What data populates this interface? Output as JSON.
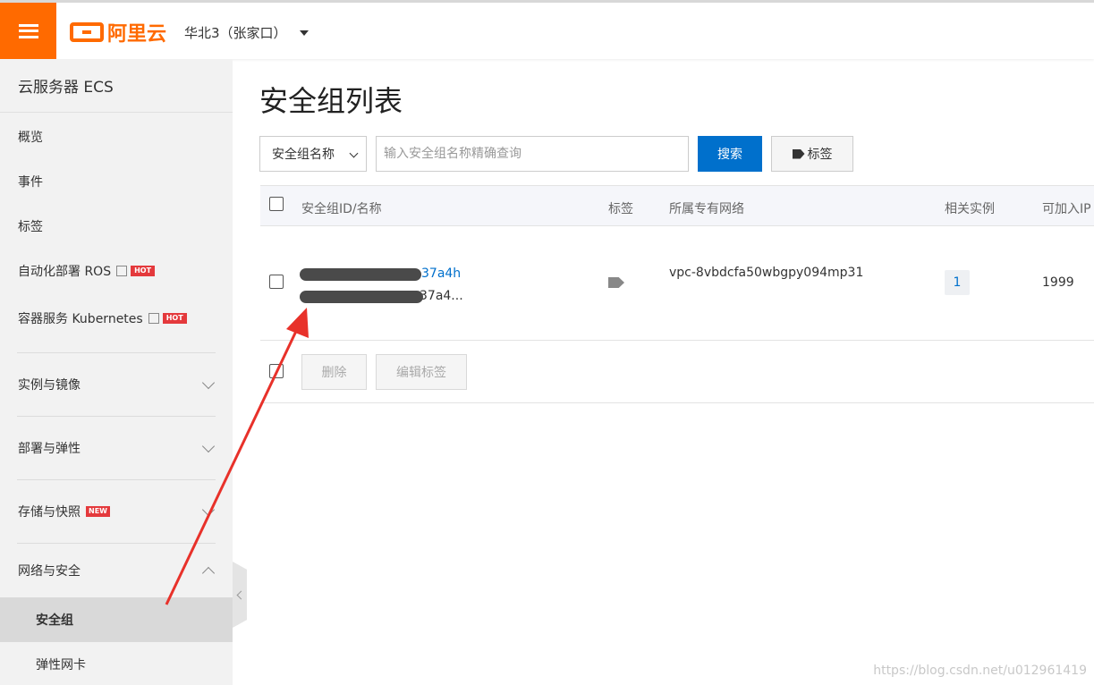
{
  "header": {
    "menu_icon": "hamburger-icon",
    "logo_text": "阿里云",
    "region": "华北3（张家口）",
    "brand_color": "#ff6a00"
  },
  "sidebar": {
    "title": "云服务器 ECS",
    "items": [
      {
        "label": "概览"
      },
      {
        "label": "事件"
      },
      {
        "label": "标签"
      },
      {
        "label": "自动化部署 ROS",
        "badge": "HOT"
      },
      {
        "label": "容器服务 Kubernetes",
        "badge": "HOT"
      }
    ],
    "groups": [
      {
        "label": "实例与镜像"
      },
      {
        "label": "部署与弹性"
      },
      {
        "label": "存储与快照",
        "badge": "NEW"
      },
      {
        "label": "网络与安全"
      }
    ],
    "sub_items": [
      {
        "label": "安全组"
      },
      {
        "label": "弹性网卡"
      }
    ]
  },
  "main": {
    "title": "安全组列表",
    "filter_select": "安全组名称",
    "search_placeholder": "输入安全组名称精确查询",
    "search_button": "搜索",
    "tag_button": "标签",
    "columns": [
      "安全组ID/名称",
      "标签",
      "所属专有网络",
      "相关实例",
      "可加入IP"
    ],
    "row": {
      "id_visible": "37a4h",
      "name_visible": "37a4...",
      "vpc": "vpc-8vbdcfa50wbgpy094mp31",
      "instances": "1",
      "ip_count": "1999"
    },
    "delete_button": "删除",
    "edit_tags_button": "编辑标签"
  },
  "watermark": "https://blog.csdn.net/u012961419",
  "colors": {
    "primary": "#0070cc",
    "accent": "#ff6a00",
    "annotation": "#e8312a"
  }
}
